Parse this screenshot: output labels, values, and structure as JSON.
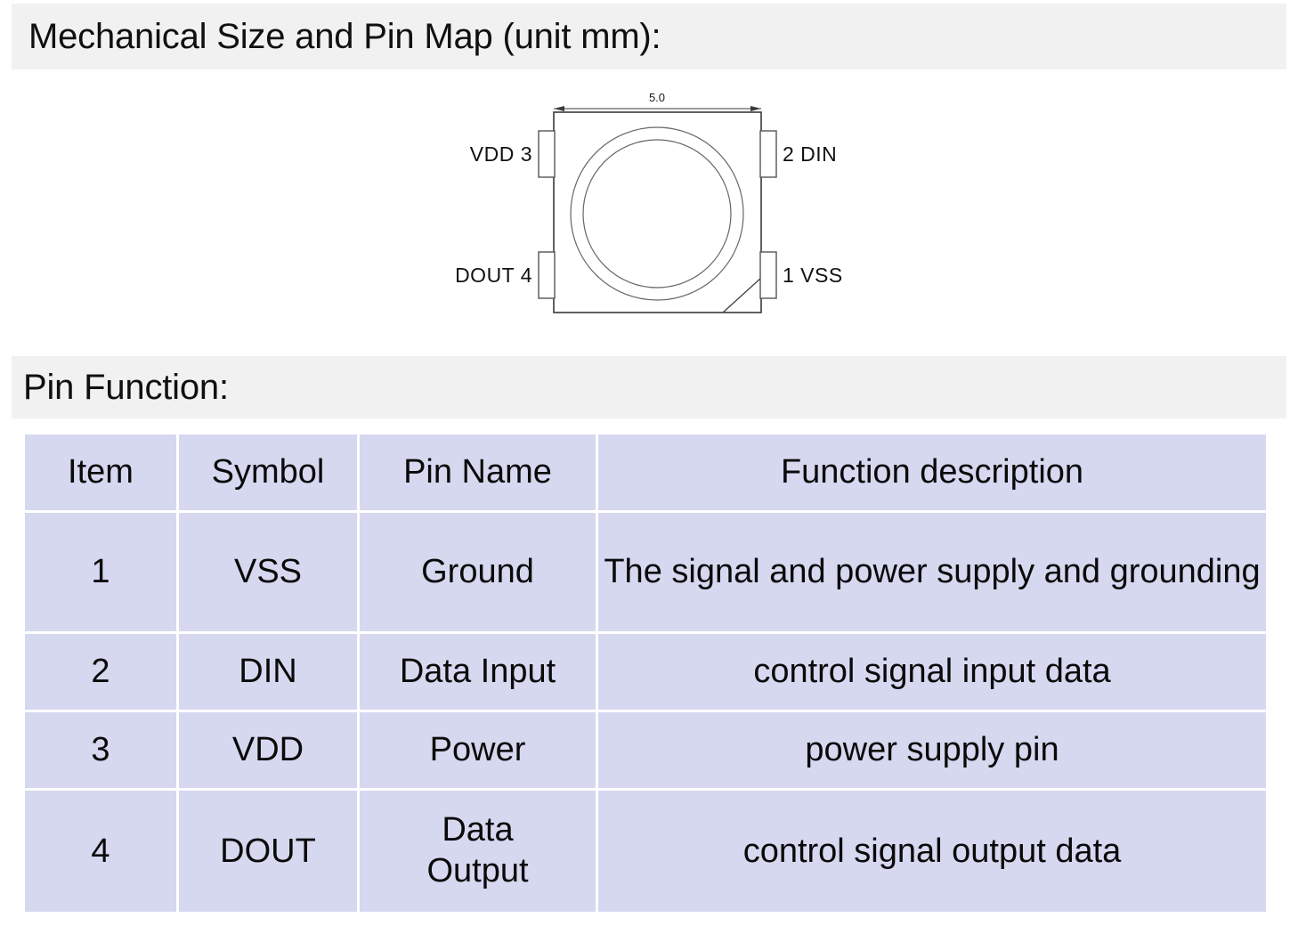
{
  "sections": {
    "mechanical": {
      "title": "Mechanical Size and Pin Map (unit mm):"
    },
    "pin_function": {
      "title": "Pin Function:"
    }
  },
  "drawing": {
    "name": "led-package-top-view",
    "dimension_label": "5.0",
    "dimension_unit": "mm",
    "pins": [
      {
        "number": "3",
        "name": "VDD",
        "label": "VDD  3",
        "side": "left",
        "position": "top"
      },
      {
        "number": "2",
        "name": "DIN",
        "label": "2  DIN",
        "side": "right",
        "position": "top"
      },
      {
        "number": "4",
        "name": "DOUT",
        "label": "DOUT 4",
        "side": "left",
        "position": "bottom"
      },
      {
        "number": "1",
        "name": "VSS",
        "label": "1  VSS",
        "side": "right",
        "position": "bottom"
      }
    ]
  },
  "table": {
    "headers": [
      "Item",
      "Symbol",
      "Pin Name",
      "Function description"
    ],
    "rows": [
      {
        "item": "1",
        "symbol": "VSS",
        "pin_name": "Ground",
        "function": "The signal and power supply and grounding"
      },
      {
        "item": "2",
        "symbol": "DIN",
        "pin_name": "Data Input",
        "function": "control signal input data"
      },
      {
        "item": "3",
        "symbol": "VDD",
        "pin_name": "Power",
        "function": "power supply pin"
      },
      {
        "item": "4",
        "symbol": "DOUT",
        "pin_name_line1": "Data",
        "pin_name_line2": "Output",
        "pin_name": "Data Output",
        "function": "control signal output data"
      }
    ]
  },
  "colors": {
    "band_background": "#f1f1f1",
    "table_cell_background": "#d6d8f0",
    "table_gridline": "#ffffff",
    "text": "#000000",
    "drawing_line": "#3a3a3a"
  }
}
